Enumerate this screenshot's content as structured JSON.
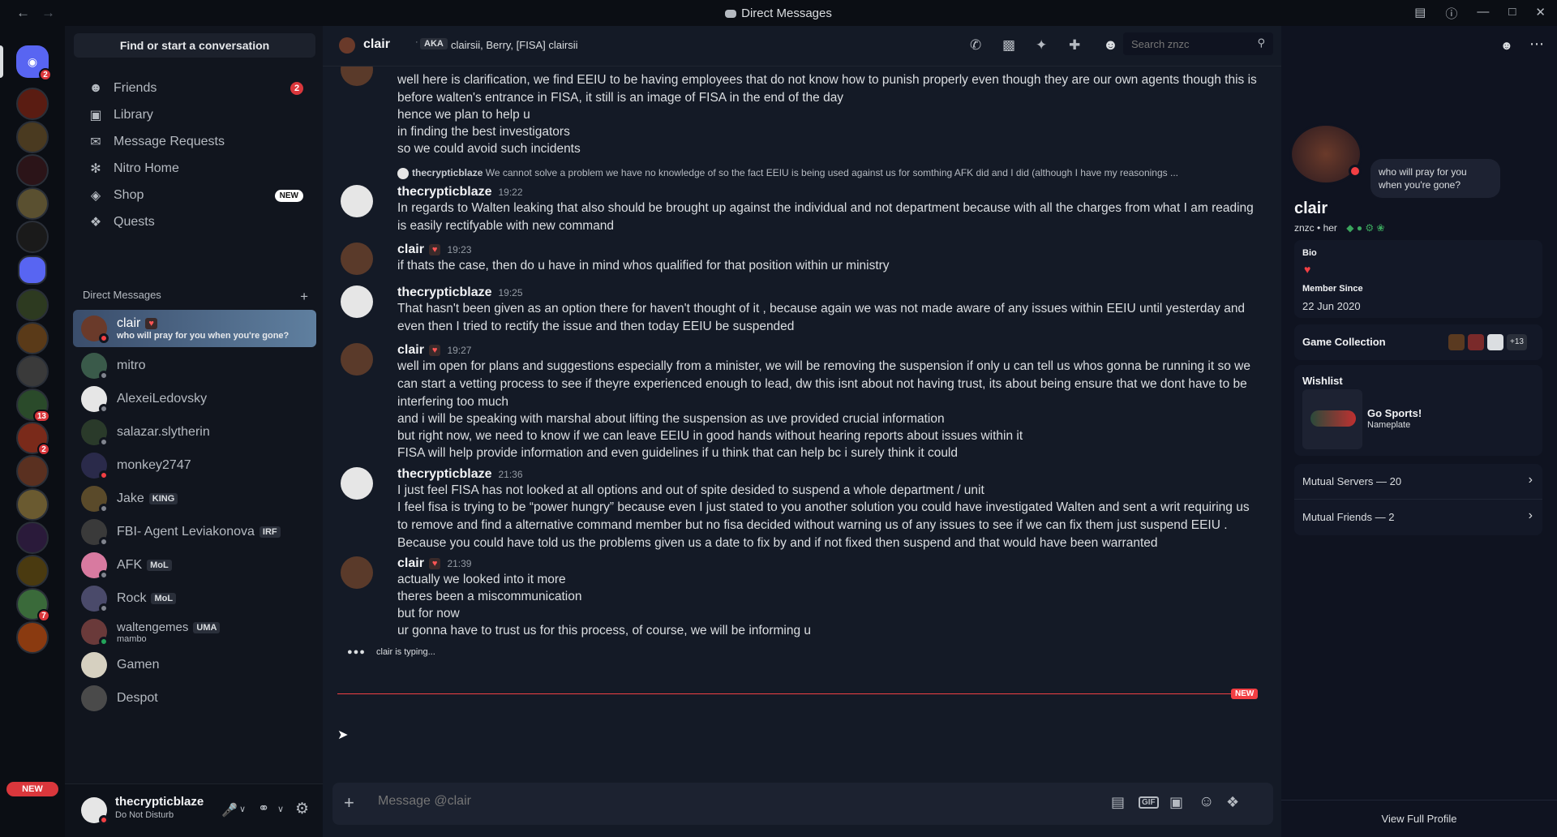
{
  "window": {
    "title": "Direct Messages"
  },
  "rail": {
    "badges": [
      "2",
      "13",
      "2",
      "7"
    ],
    "new_label": "NEW"
  },
  "sidebar": {
    "find_label": "Find or start a conversation",
    "nav": [
      {
        "label": "Friends",
        "icon": "friends-icon",
        "badge": "2"
      },
      {
        "label": "Library",
        "icon": "library-icon"
      },
      {
        "label": "Message Requests",
        "icon": "mail-icon"
      },
      {
        "label": "Nitro Home",
        "icon": "nitro-icon"
      },
      {
        "label": "Shop",
        "icon": "shop-icon",
        "badge": "NEW"
      },
      {
        "label": "Quests",
        "icon": "quests-icon"
      }
    ],
    "dm_header": "Direct Messages",
    "dms": [
      {
        "name": "clair",
        "status_text": "who will pray for you when you're gone?"
      },
      {
        "name": "mitro"
      },
      {
        "name": "AlexeiLedovsky"
      },
      {
        "name": "salazar.slytherin"
      },
      {
        "name": "monkey2747"
      },
      {
        "name": "Jake",
        "tag": "KING"
      },
      {
        "name": "FBI- Agent Leviakonova",
        "tag": "IRF"
      },
      {
        "name": "AFK",
        "tag": "MoL"
      },
      {
        "name": "Rock",
        "tag": "MoL"
      },
      {
        "name": "waltengemes",
        "tag": "UMA",
        "status_text": "mambo"
      },
      {
        "name": "Gamen"
      },
      {
        "name": "Despot"
      }
    ]
  },
  "user": {
    "name": "thecrypticblaze",
    "status": "Do Not Disturb"
  },
  "chat": {
    "name": "clair",
    "aka_label": "AKA",
    "aka": "clairsii, Berry, [FISA] clairsii",
    "search_placeholder": "Search znzc",
    "composer_placeholder": "Message @clair",
    "typing": "clair is typing...",
    "new_label": "NEW",
    "reply_author": "thecrypticblaze",
    "reply_text": "We cannot solve a problem we have no knowledge of so the fact EEIU  is being used against us for somthing AFK did and I did (although I have my reasonings ...",
    "messages": [
      {
        "author": "",
        "time": "",
        "lines": [
          "well here is clarification, we find EEIU to be having employees that do not know how to punish properly even though they are our own agents though this is before walten's entrance in FISA, it still is an image of FISA in the end of the day",
          "hence we plan to help u",
          "in finding the best investigators",
          "so we could avoid such incidents"
        ]
      },
      {
        "author": "thecrypticblaze",
        "time": "19:22",
        "lines": [
          "In regards to Walten leaking that also should be brought up against the individual and not department because with all the charges from what I am reading is easily rectifyable with new command"
        ]
      },
      {
        "author": "clair",
        "time": "19:23",
        "lines": [
          "if thats the case, then do u have in mind whos qualified for that position within ur ministry"
        ]
      },
      {
        "author": "thecrypticblaze",
        "time": "19:25",
        "lines": [
          "That hasn't been given as an option there for haven't thought of it , because again we was not made aware of any issues within EEIU until yesterday and even then I tried to rectify the issue and then today EEIU be suspended"
        ]
      },
      {
        "author": "clair",
        "time": "19:27",
        "lines": [
          "well im open for plans and suggestions especially from a minister, we will be removing the suspension if only u can tell us whos gonna be running it so we can start a vetting process to see if theyre experienced enough to lead, dw this isnt about not having trust, its about being ensure that we dont have to be interfering too much",
          "and i will be speaking with marshal about lifting the suspension as uve provided crucial information",
          "but right now, we need to know if we can leave EEIU in good hands without hearing reports about issues within it",
          "FISA will help provide information and even guidelines if u think that can help bc i surely think it could"
        ]
      },
      {
        "author": "thecrypticblaze",
        "time": "21:36",
        "lines": [
          "I just feel FISA has not looked at all options and out of spite desided to suspend a whole department / unit",
          "I feel fisa is trying to be “power hungry” because even I just stated to you another solution you could have investigated Walten and sent a writ requiring us to remove and find a alternative command member but no fisa decided without warning us of any issues to see if we can fix them just suspend EEIU . Because you could have told us the problems given us a date to fix by and if not fixed then suspend and that would have been warranted"
        ]
      },
      {
        "author": "clair",
        "time": "21:39",
        "lines": [
          "actually we looked into it more",
          "theres been a miscommunication",
          "but for now",
          "ur gonna have to trust us for this process, of course, we will be informing u"
        ]
      }
    ]
  },
  "profile": {
    "display_name": "clair",
    "username": "znzc",
    "pronouns": "her",
    "status_bubble": "who will pray for you when you're gone?",
    "bio_label": "Bio",
    "member_since_label": "Member Since",
    "member_since": "22 Jun 2020",
    "game_collection_label": "Game Collection",
    "game_more": "+13",
    "wishlist_label": "Wishlist",
    "wishlist_item": "Go Sports!",
    "wishlist_type": "Nameplate",
    "mutual_servers": "Mutual Servers — 20",
    "mutual_friends": "Mutual Friends — 2",
    "view_full": "View Full Profile"
  }
}
